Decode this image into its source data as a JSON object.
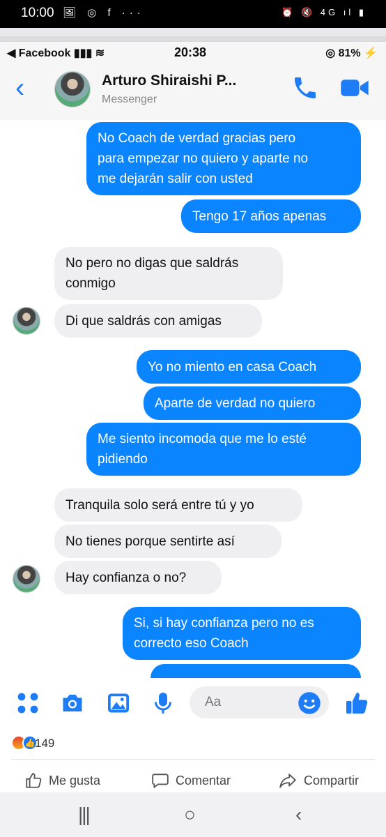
{
  "outer_status": {
    "time": "10:00",
    "left_icons": "🖼 ◎ f  ···",
    "right_icons": "⏰ 🔇 4G ıl ▮"
  },
  "inner_status": {
    "carrier": "◀ Facebook ▮▮▮ ≋",
    "time": "20:38",
    "battery": "◎ 81% ⚡"
  },
  "header": {
    "back": "‹",
    "name": "Arturo Shiraishi P...",
    "subtitle": "Messenger"
  },
  "messages": [
    {
      "dir": "out",
      "text": "No Coach de verdad gracias pero\npara empezar no quiero y aparte no\nme dejarán salir con usted"
    },
    {
      "dir": "out",
      "text": "Tengo 17 años apenas"
    },
    {
      "dir": "in",
      "text": "No pero no digas que saldrás\nconmigo"
    },
    {
      "dir": "in",
      "text": "Di que saldrás con amigas"
    },
    {
      "dir": "out",
      "text": "Yo no miento en casa Coach"
    },
    {
      "dir": "out",
      "text": "Aparte de verdad no quiero"
    },
    {
      "dir": "out",
      "text": "Me siento incomoda que me lo esté\npidiendo"
    },
    {
      "dir": "in",
      "text": "Tranquila solo será entre tú y yo"
    },
    {
      "dir": "in",
      "text": "No tienes porque sentirte así"
    },
    {
      "dir": "in",
      "text": "Hay confianza o no?"
    },
    {
      "dir": "out",
      "text": "Si, si hay confianza pero no es\ncorrecto eso Coach"
    }
  ],
  "composer": {
    "placeholder": "Aa"
  },
  "post": {
    "reaction_count": "149",
    "like_label": "Me gusta",
    "comment_label": "Comentar",
    "share_label": "Compartir"
  },
  "android_nav": {
    "recent": "|||",
    "home": "○",
    "back": "‹"
  },
  "colors": {
    "outgoing": "#0a84ff",
    "incoming": "#efeff1",
    "accent": "#1f7cf7"
  }
}
